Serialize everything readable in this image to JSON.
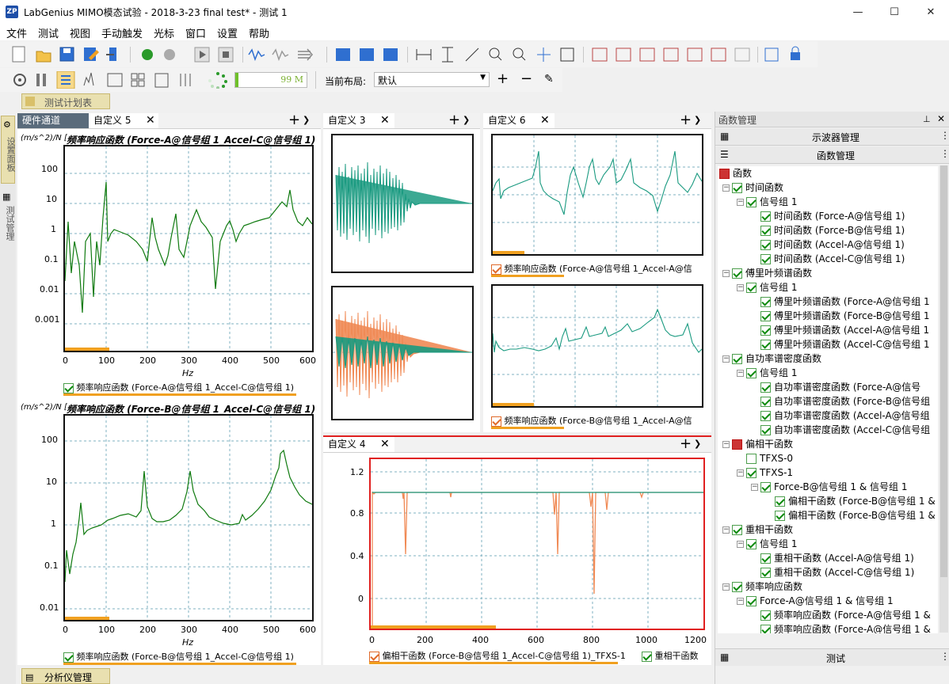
{
  "window": {
    "title": "LabGenius MIMO模态试验 - 2018-3-23 final test* - 测试 1",
    "logo": "ZP"
  },
  "menu": [
    "文件",
    "测试",
    "视图",
    "手动触发",
    "光标",
    "窗口",
    "设置",
    "帮助"
  ],
  "toolbar2": {
    "progress_value": "99 M",
    "layout_label": "当前布局:",
    "layout_value": "默认"
  },
  "test_plan_tab": "测试计划表",
  "left_vertical_tabs": [
    "设置面板",
    "测试管理"
  ],
  "bottom_tab": "分析仪管理",
  "panel_left": {
    "tabs": [
      "硬件通道",
      "自定义 5"
    ],
    "chart1": {
      "title": "频率响应函数 (Force-A@信号组 1_Accel-C@信号组 1)",
      "yunit": "(m/s^2)/N [",
      "xlabel": "Hz",
      "yticks": [
        "100",
        "10",
        "1",
        "0.1",
        "0.01",
        "0.001"
      ],
      "xticks": [
        "0",
        "100",
        "200",
        "300",
        "400",
        "500",
        "600"
      ],
      "legend": "频率响应函数 (Force-A@信号组 1_Accel-C@信号组 1)"
    },
    "chart2": {
      "title": "频率响应函数 (Force-B@信号组 1_Accel-C@信号组 1)",
      "yunit": "(m/s^2)/N [",
      "xlabel": "Hz",
      "yticks": [
        "100",
        "10",
        "1",
        "0.1",
        "0.01"
      ],
      "xticks": [
        "0",
        "100",
        "200",
        "300",
        "400",
        "500",
        "600"
      ],
      "legend": "频率响应函数 (Force-B@信号组 1_Accel-C@信号组 1)"
    }
  },
  "panel_mid": {
    "tabs": [
      "自定义 3"
    ]
  },
  "panel_right": {
    "tabs": [
      "自定义 6"
    ],
    "legend1": "频率响应函数 (Force-A@信号组 1_Accel-A@信",
    "legend2": "频率响应函数 (Force-B@信号组 1_Accel-A@信"
  },
  "panel_bottom": {
    "tabs": [
      "自定义 4"
    ],
    "yticks": [
      "1.2",
      "0.8",
      "0.4",
      "0"
    ],
    "xticks": [
      "0",
      "200",
      "400",
      "600",
      "800",
      "1000",
      "1200"
    ],
    "legend1": "偏相干函数 (Force-B@信号组 1_Accel-C@信号组 1)_TFXS-1",
    "legend2": "重相干函数"
  },
  "func_panel": {
    "title": "函数管理",
    "sections": [
      "示波器管理",
      "函数管理"
    ],
    "footer": "测试",
    "tree": [
      {
        "t": "函数",
        "level": 0,
        "cb": "red",
        "exp": false
      },
      {
        "t": "时间函数",
        "level": 1,
        "cb": "on",
        "exp": true
      },
      {
        "t": "信号组 1",
        "level": 2,
        "cb": "on",
        "exp": true
      },
      {
        "t": "时间函数 (Force-A@信号组 1)",
        "level": 3,
        "cb": "on"
      },
      {
        "t": "时间函数 (Force-B@信号组 1)",
        "level": 3,
        "cb": "on"
      },
      {
        "t": "时间函数 (Accel-A@信号组 1)",
        "level": 3,
        "cb": "on"
      },
      {
        "t": "时间函数 (Accel-C@信号组 1)",
        "level": 3,
        "cb": "on"
      },
      {
        "t": "傅里叶频谱函数",
        "level": 1,
        "cb": "on",
        "exp": true
      },
      {
        "t": "信号组 1",
        "level": 2,
        "cb": "on",
        "exp": true
      },
      {
        "t": "傅里叶频谱函数 (Force-A@信号组 1",
        "level": 3,
        "cb": "on"
      },
      {
        "t": "傅里叶频谱函数 (Force-B@信号组 1",
        "level": 3,
        "cb": "on"
      },
      {
        "t": "傅里叶频谱函数 (Accel-A@信号组 1",
        "level": 3,
        "cb": "on"
      },
      {
        "t": "傅里叶频谱函数 (Accel-C@信号组 1",
        "level": 3,
        "cb": "on"
      },
      {
        "t": "自功率谱密度函数",
        "level": 1,
        "cb": "on",
        "exp": true
      },
      {
        "t": "信号组 1",
        "level": 2,
        "cb": "on",
        "exp": true
      },
      {
        "t": "自功率谱密度函数 (Force-A@信号",
        "level": 3,
        "cb": "on"
      },
      {
        "t": "自功率谱密度函数 (Force-B@信号组",
        "level": 3,
        "cb": "on"
      },
      {
        "t": "自功率谱密度函数 (Accel-A@信号组",
        "level": 3,
        "cb": "on"
      },
      {
        "t": "自功率谱密度函数 (Accel-C@信号组",
        "level": 3,
        "cb": "on"
      },
      {
        "t": "偏相干函数",
        "level": 1,
        "cb": "red",
        "exp": true
      },
      {
        "t": "TFXS-0",
        "level": 2,
        "cb": "off"
      },
      {
        "t": "TFXS-1",
        "level": 2,
        "cb": "on",
        "exp": true
      },
      {
        "t": "Force-B@信号组 1 & 信号组 1",
        "level": 3,
        "cb": "on",
        "exp": true
      },
      {
        "t": "偏相干函数 (Force-B@信号组 1 &",
        "level": 4,
        "cb": "on"
      },
      {
        "t": "偏相干函数 (Force-B@信号组 1 &",
        "level": 4,
        "cb": "on"
      },
      {
        "t": "重相干函数",
        "level": 1,
        "cb": "on",
        "exp": true
      },
      {
        "t": "信号组 1",
        "level": 2,
        "cb": "on",
        "exp": true
      },
      {
        "t": "重相干函数 (Accel-A@信号组 1)",
        "level": 3,
        "cb": "on"
      },
      {
        "t": "重相干函数 (Accel-C@信号组 1)",
        "level": 3,
        "cb": "on"
      },
      {
        "t": "频率响应函数",
        "level": 1,
        "cb": "on",
        "exp": true
      },
      {
        "t": "Force-A@信号组 1 & 信号组 1",
        "level": 2,
        "cb": "on",
        "exp": true
      },
      {
        "t": "频率响应函数 (Force-A@信号组 1 &",
        "level": 3,
        "cb": "on"
      },
      {
        "t": "频率响应函数 (Force-A@信号组 1 &",
        "level": 3,
        "cb": "on"
      }
    ]
  },
  "colors": {
    "green": "#0f7a0f",
    "teal": "#1a9a80",
    "orange": "#f08a55",
    "accent": "#f0a020",
    "red": "#e02020"
  }
}
